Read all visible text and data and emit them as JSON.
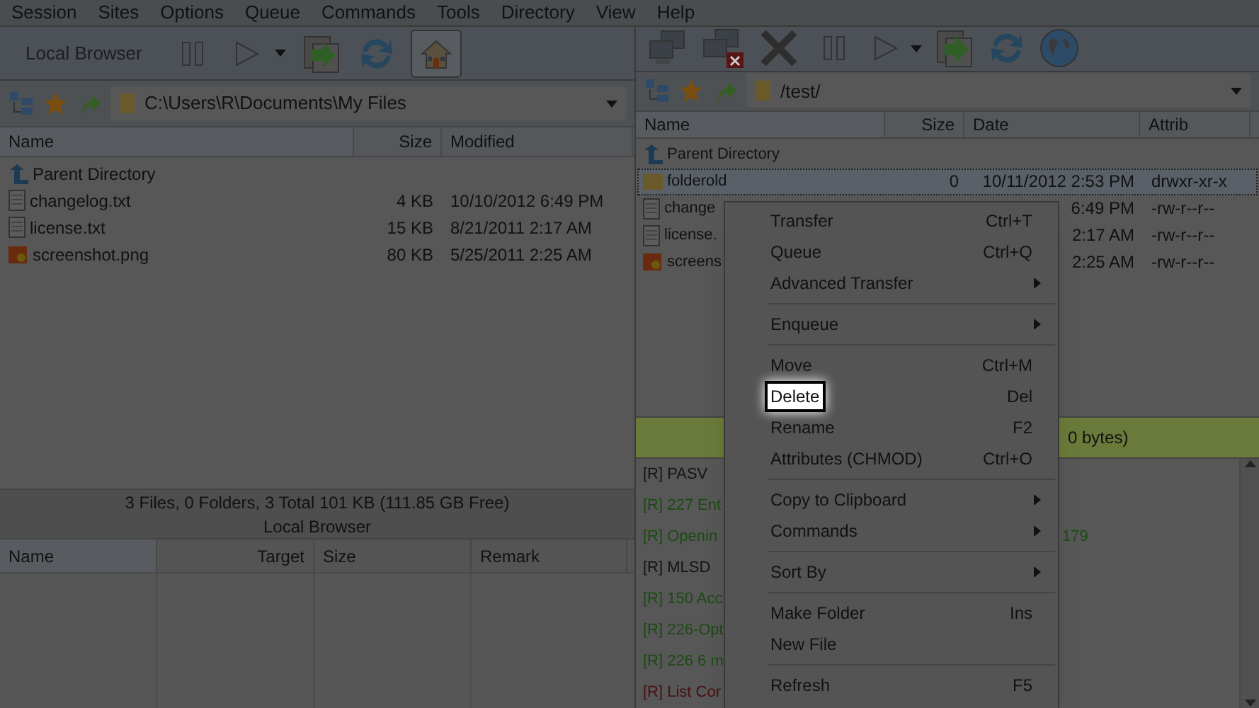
{
  "menu_bar": [
    "Session",
    "Sites",
    "Options",
    "Queue",
    "Commands",
    "Tools",
    "Directory",
    "View",
    "Help"
  ],
  "local": {
    "toolbar_label": "Local Browser",
    "path": "C:\\Users\\R\\Documents\\My Files",
    "columns": [
      "Name",
      "Size",
      "Modified"
    ],
    "rows": [
      {
        "kind": "parent",
        "name": "Parent Directory"
      },
      {
        "kind": "text",
        "name": "changelog.txt",
        "size": "4 KB",
        "date": "10/10/2012 6:49 PM"
      },
      {
        "kind": "text",
        "name": "license.txt",
        "size": "15 KB",
        "date": "8/21/2011 2:17 AM"
      },
      {
        "kind": "image",
        "name": "screenshot.png",
        "size": "80 KB",
        "date": "5/25/2011 2:25 AM"
      }
    ],
    "status": "3 Files, 0 Folders, 3 Total 101 KB (111.85 GB Free)",
    "caption": "Local Browser"
  },
  "remote": {
    "path": "/test/",
    "columns": [
      "Name",
      "Size",
      "Date",
      "Attrib"
    ],
    "rows": [
      {
        "kind": "parent",
        "name": "Parent Directory",
        "selected": false
      },
      {
        "kind": "folder",
        "name": "folderold",
        "size": "0",
        "date": "10/11/2012 2:53 PM",
        "attrib": "drwxr-xr-x",
        "selected": true
      },
      {
        "kind": "text",
        "name": "change",
        "date": "6:49 PM",
        "attrib": "-rw-r--r--",
        "selected": false
      },
      {
        "kind": "text",
        "name": "license.",
        "date": "2:17 AM",
        "attrib": "-rw-r--r--",
        "selected": false
      },
      {
        "kind": "image",
        "name": "screens",
        "date": "2:25 AM",
        "attrib": "-rw-r--r--",
        "selected": false
      }
    ],
    "status": "0 bytes)"
  },
  "queue": {
    "columns": [
      "Name",
      "Target",
      "Size",
      "Remark"
    ]
  },
  "log": [
    {
      "kind": "command",
      "text": "[R] PASV"
    },
    {
      "kind": "reply",
      "text": "[R] 227 Ent"
    },
    {
      "kind": "reply",
      "text": "[R] Openin",
      "tail": "179"
    },
    {
      "kind": "command",
      "text": "[R] MLSD"
    },
    {
      "kind": "reply",
      "text": "[R] 150 Acc"
    },
    {
      "kind": "reply",
      "text": "[R] 226-Opt"
    },
    {
      "kind": "reply",
      "text": "[R] 226 6 m"
    },
    {
      "kind": "error",
      "text": "[R] List Cor"
    }
  ],
  "context_menu": [
    {
      "kind": "item",
      "label": "Transfer",
      "shortcut": "Ctrl+T",
      "submenu": false,
      "highlighted": false
    },
    {
      "kind": "item",
      "label": "Queue",
      "shortcut": "Ctrl+Q",
      "submenu": false,
      "highlighted": false
    },
    {
      "kind": "item",
      "label": "Advanced Transfer",
      "submenu": true,
      "highlighted": false
    },
    {
      "kind": "separator"
    },
    {
      "kind": "item",
      "label": "Enqueue",
      "submenu": true,
      "highlighted": false
    },
    {
      "kind": "separator"
    },
    {
      "kind": "item",
      "label": "Move",
      "shortcut": "Ctrl+M",
      "submenu": false,
      "highlighted": false
    },
    {
      "kind": "item",
      "label": "Delete",
      "shortcut": "Del",
      "submenu": false,
      "highlighted": true
    },
    {
      "kind": "item",
      "label": "Rename",
      "shortcut": "F2",
      "submenu": false,
      "highlighted": false
    },
    {
      "kind": "item",
      "label": "Attributes (CHMOD)",
      "shortcut": "Ctrl+O",
      "submenu": false,
      "highlighted": false
    },
    {
      "kind": "separator"
    },
    {
      "kind": "item",
      "label": "Copy to Clipboard",
      "submenu": true,
      "highlighted": false
    },
    {
      "kind": "item",
      "label": "Commands",
      "submenu": true,
      "highlighted": false
    },
    {
      "kind": "separator"
    },
    {
      "kind": "item",
      "label": "Sort By",
      "submenu": true,
      "highlighted": false
    },
    {
      "kind": "separator"
    },
    {
      "kind": "item",
      "label": "Make Folder",
      "shortcut": "Ins",
      "submenu": false,
      "highlighted": false
    },
    {
      "kind": "item",
      "label": "New File",
      "submenu": false,
      "highlighted": false
    },
    {
      "kind": "separator"
    },
    {
      "kind": "item",
      "label": "Refresh",
      "shortcut": "F5",
      "submenu": false,
      "highlighted": false
    }
  ]
}
